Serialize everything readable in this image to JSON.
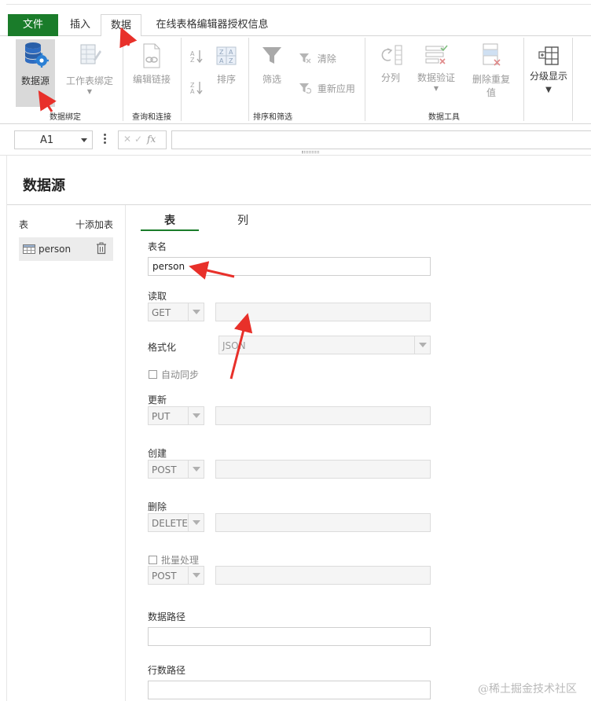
{
  "ribbon": {
    "tabs": {
      "file": "文件",
      "insert": "插入",
      "data": "数据",
      "license": "在线表格编辑器授权信息"
    },
    "buttons": {
      "data_source": "数据源",
      "sheet_bind_line1": "工作表绑定",
      "edit_links": "编辑链接",
      "sort": "排序",
      "filter": "筛选",
      "clear": "清除",
      "reapply": "重新应用",
      "split_column": "分列",
      "data_validation": "数据验证",
      "remove_dup_line1": "删除重复",
      "remove_dup_line2": "值",
      "outline": "分级显示"
    },
    "groups": {
      "binding": "数据绑定",
      "query": "查询和连接",
      "sort_filter": "排序和筛选",
      "tools": "数据工具"
    }
  },
  "formula_bar": {
    "cell_ref": "A1",
    "fx": "fx"
  },
  "panel": {
    "title": "数据源",
    "sidebar": {
      "label": "表",
      "add": "十添加表",
      "tables": [
        {
          "name": "person"
        }
      ]
    },
    "tabs": {
      "table": "表",
      "columns": "列"
    },
    "form": {
      "table_name_label": "表名",
      "table_name_value": "person",
      "read_label": "读取",
      "read_method": "GET",
      "format_label": "格式化",
      "format_value": "JSON",
      "auto_sync": "自动同步",
      "update_label": "更新",
      "update_method": "PUT",
      "create_label": "创建",
      "create_method": "POST",
      "delete_label": "删除",
      "delete_method": "DELETE",
      "batch": "批量处理",
      "batch_method": "POST",
      "data_path_label": "数据路径",
      "row_count_path_label": "行数路径"
    }
  },
  "watermark": "@稀土掘金技术社区",
  "colors": {
    "file_tab": "#1a7c2a",
    "active_underline": "#1a7c2a",
    "annotation_arrow": "#e8302a",
    "db_icon": "#2a5fa8"
  }
}
